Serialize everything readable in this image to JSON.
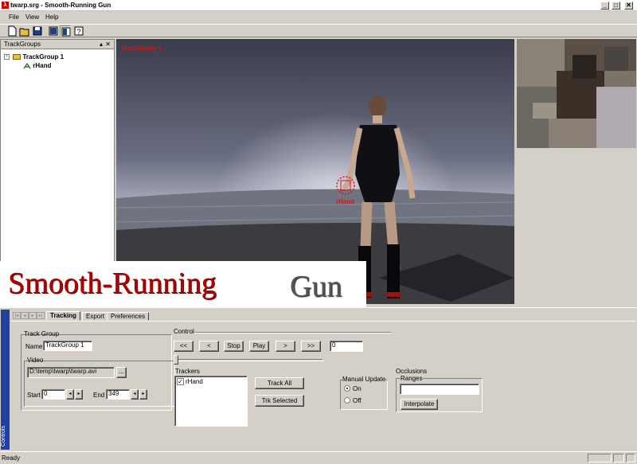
{
  "window": {
    "title": "twarp.srg - Smooth-Running Gun",
    "controls": {
      "minimize": "_",
      "maximize": "□",
      "close": "✕"
    }
  },
  "menu": {
    "items": [
      "File",
      "View",
      "Help"
    ]
  },
  "toolbar": {
    "icons": [
      "new-icon",
      "open-icon",
      "save-icon",
      "layout-single-icon",
      "layout-split-icon",
      "help-icon"
    ]
  },
  "trackgroups_panel": {
    "title": "TrackGroups",
    "tree": {
      "group": "TrackGroup 1",
      "tracker": "rHand"
    }
  },
  "viewport": {
    "overlay_label": "TrackGroup 1",
    "tracker_label": "rHand"
  },
  "banner": {
    "word1": "Smooth-Running",
    "word2": "Gun"
  },
  "controls_panel": {
    "side_tab": "Controls",
    "tabs": [
      "Tracking",
      "Export",
      "Preferences"
    ],
    "active_tab": "Tracking",
    "track_group": {
      "legend": "Track Group",
      "name_label": "Name",
      "name_value": "TrackGroup 1",
      "video_legend": "Video",
      "video_path": "D:\\temp\\twarp\\twarp.avi",
      "browse_label": "...",
      "start_label": "Start",
      "start_value": "0",
      "end_label": "End",
      "end_value": "349"
    },
    "control": {
      "legend": "Control",
      "buttons": [
        "<<",
        "<",
        "Stop",
        "Play",
        ">",
        ">>"
      ],
      "frame_value": "0",
      "slider_position": 0
    },
    "trackers": {
      "legend": "Trackers",
      "items": [
        {
          "label": "rHand",
          "checked": true
        }
      ],
      "track_all_label": "Track All",
      "trk_selected_label": "Trk Selected"
    },
    "manual_update": {
      "legend": "Manual Update",
      "on_label": "On",
      "off_label": "Off",
      "selected": "On"
    },
    "occlusions": {
      "legend": "Occlusions",
      "ranges_legend": "Ranges",
      "ranges_value": "",
      "interpolate_label": "Interpolate"
    }
  },
  "status": {
    "text": "Ready"
  },
  "colors": {
    "side_tab": "#2240a0",
    "tracker_red": "#e01010",
    "banner_red": "#b00000"
  }
}
